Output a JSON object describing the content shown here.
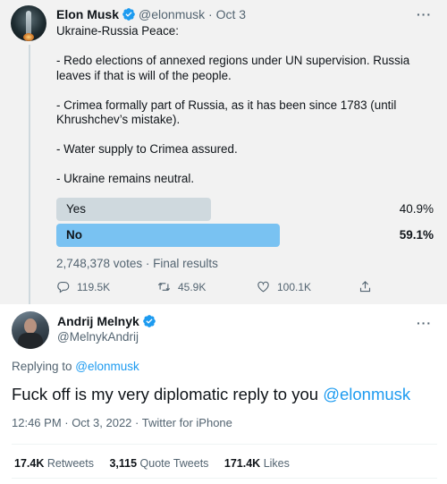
{
  "parent_tweet": {
    "author_name": "Elon Musk",
    "handle": "@elonmusk",
    "separator": "·",
    "date": "Oct 3",
    "more": "···",
    "text_lines": [
      "Ukraine-Russia Peace:",
      "",
      "- Redo elections of annexed regions under UN supervision. Russia leaves if that is will of the people.",
      "",
      "- Crimea formally part of Russia, as it has been since 1783 (until Khrushchev’s mistake).",
      "",
      "- Water supply to Crimea assured.",
      "",
      "- Ukraine remains neutral."
    ],
    "poll": {
      "options": [
        {
          "label": "Yes",
          "percent_text": "40.9%",
          "share": 0.409,
          "winner": false
        },
        {
          "label": "No",
          "percent_text": "59.1%",
          "share": 0.591,
          "winner": true
        }
      ],
      "votes_text": "2,748,378 votes · Final results"
    },
    "actions": {
      "replies": "119.5K",
      "retweets": "45.9K",
      "likes": "100.1K"
    }
  },
  "reply_tweet": {
    "author_name": "Andrij Melnyk",
    "handle": "@MelnykAndrij",
    "more": "···",
    "replying_prefix": "Replying to ",
    "replying_to": "@elonmusk",
    "text_main": "Fuck off is my very diplomatic reply to you ",
    "text_mention": "@elonmusk",
    "meta": "12:46 PM · Oct 3, 2022 · Twitter for iPhone",
    "stats": {
      "retweets_count": "17.4K",
      "retweets_label": "Retweets",
      "quotes_count": "3,115",
      "quotes_label": "Quote Tweets",
      "likes_count": "171.4K",
      "likes_label": "Likes"
    }
  },
  "colors": {
    "accent": "#1d9bf0",
    "poll_winner": "#79c2f2",
    "poll_other": "#cfd9de",
    "muted_text": "#536471"
  }
}
